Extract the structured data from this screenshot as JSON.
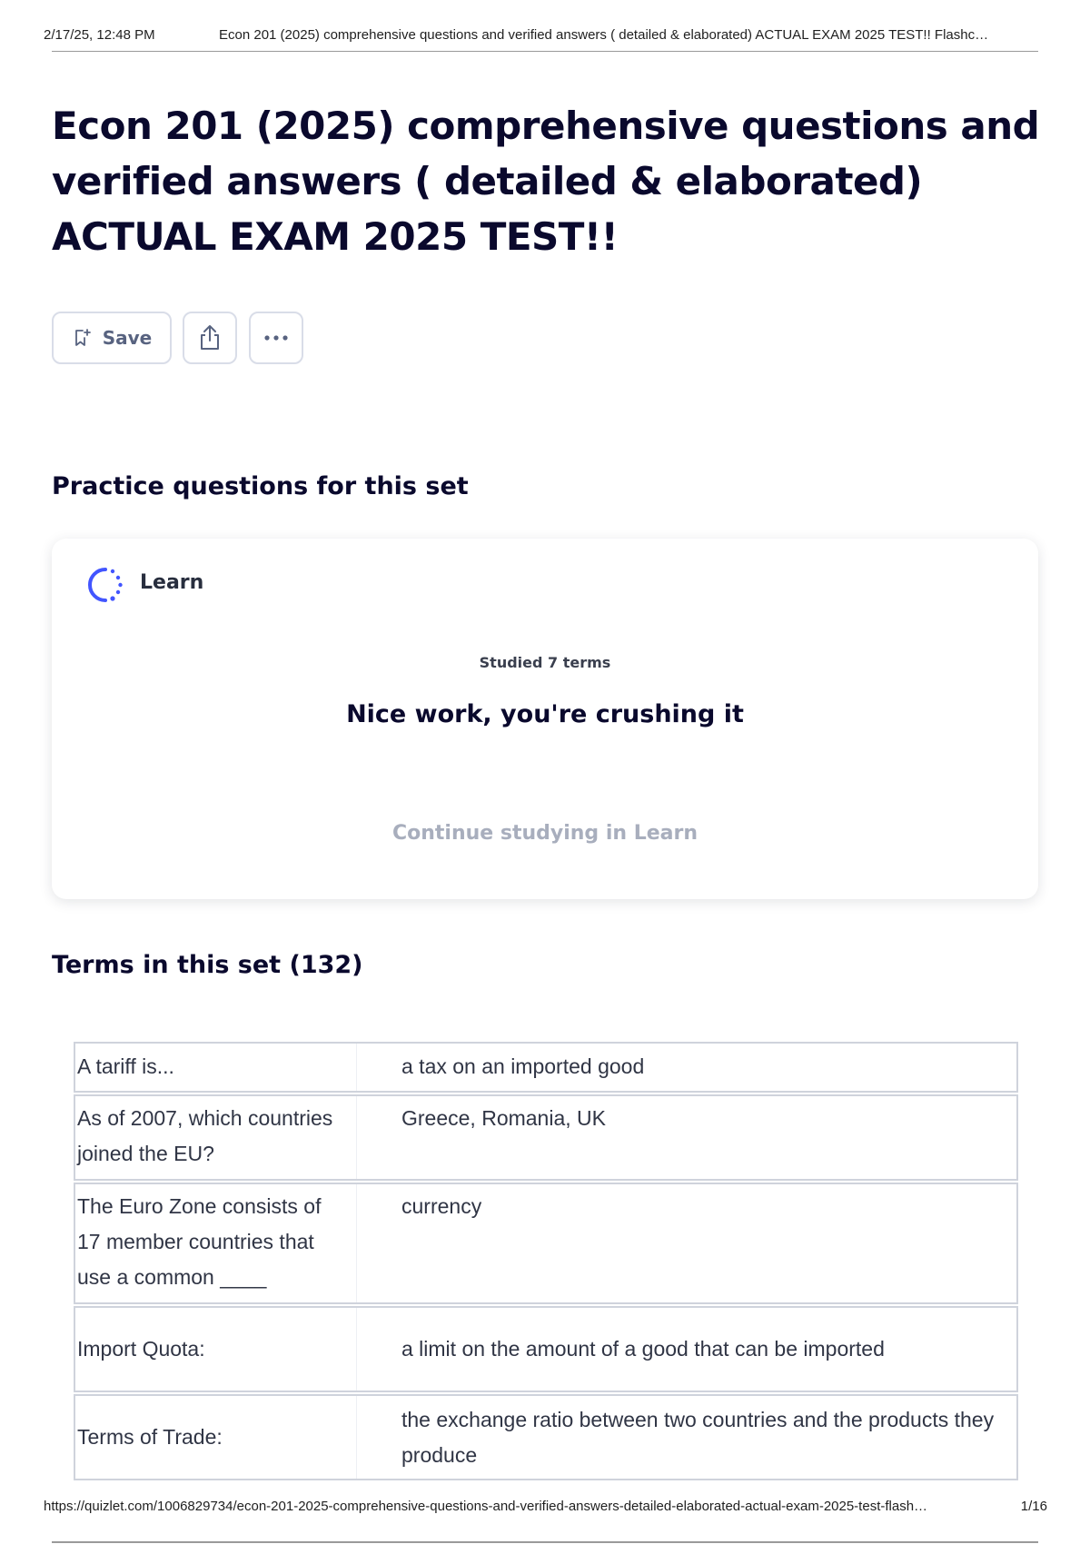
{
  "print_header": {
    "datetime": "2/17/25, 12:48 PM",
    "doc_title": "Econ 201 (2025) comprehensive questions and verified answers ( detailed & elaborated) ACTUAL EXAM 2025 TEST!! Flashc…"
  },
  "title": "Econ 201 (2025) comprehensive questions and verified answers ( detailed & elaborated) ACTUAL EXAM 2025 TEST!!",
  "toolbar": {
    "save_label": "Save",
    "save_icon": "bookmark-add-icon",
    "share_icon": "share-upload-icon",
    "more_icon": "more-dots-icon"
  },
  "practice": {
    "heading": "Practice questions for this set",
    "learn_label": "Learn",
    "learn_icon": "learn-progress-icon",
    "studied": "Studied 7 terms",
    "message": "Nice work, you're crushing it",
    "continue_label": "Continue studying in Learn"
  },
  "terms_section": {
    "heading": "Terms in this set (132)",
    "items": [
      {
        "term": "A tariff is...",
        "definition": "a tax on an imported good"
      },
      {
        "term": "As of 2007, which countries joined the EU?",
        "definition": "Greece, Romania, UK"
      },
      {
        "term": "The Euro Zone consists of 17 member countries that use a common ____",
        "definition": "currency"
      },
      {
        "term": "Import Quota:",
        "definition": "a limit on the amount of a good that can be imported"
      },
      {
        "term": "Terms of Trade:",
        "definition": "the exchange ratio between two countries and the products they produce"
      }
    ]
  },
  "print_footer": {
    "url": "https://quizlet.com/1006829734/econ-201-2025-comprehensive-questions-and-verified-answers-detailed-elaborated-actual-exam-2025-test-flash…",
    "page": "1/16"
  },
  "colors": {
    "heading": "#0a092d",
    "body_text": "#282e3e",
    "muted": "#a8aebd",
    "border": "#d9dde8",
    "learn_accent": "#4255ff"
  }
}
